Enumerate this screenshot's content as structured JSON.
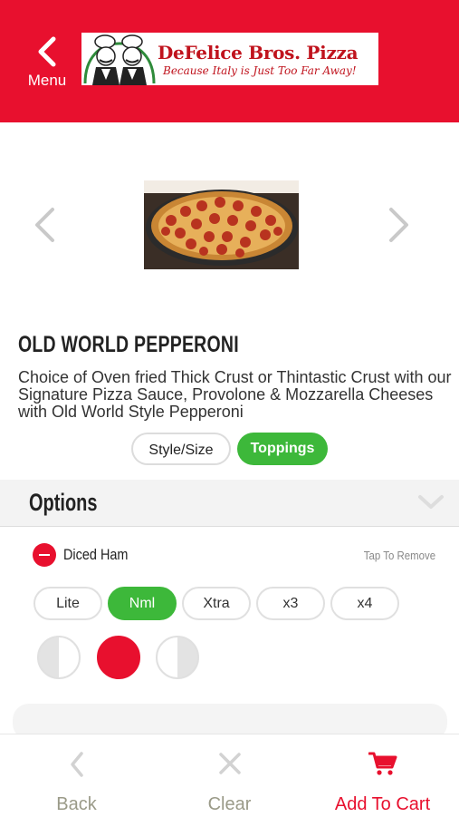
{
  "header": {
    "menu_label": "Menu",
    "logo_title": "DeFelice Bros. Pizza",
    "logo_tagline": "Because Italy is Just Too Far Away!",
    "background_color": "#e8102e"
  },
  "item": {
    "title": "OLD WORLD PEPPERONI",
    "description": "Choice of Oven fried Thick Crust or Thintastic Crust with our Signature Pizza Sauce, Provolone & Mozzarella Cheeses with Old World Style Pepperoni"
  },
  "tabs": {
    "style_size": "Style/Size",
    "toppings": "Toppings",
    "active": "Toppings"
  },
  "options": {
    "title": "Options",
    "topping": {
      "name": "Diced Ham",
      "action_hint": "Tap To Remove",
      "amounts": [
        "Lite",
        "Nml",
        "Xtra",
        "x3",
        "x4"
      ],
      "selected_amount": "Nml",
      "placement_selected": "whole"
    }
  },
  "bottom_bar": {
    "back": "Back",
    "clear": "Clear",
    "add_to_cart": "Add To Cart"
  },
  "colors": {
    "brand_red": "#e8102e",
    "active_green": "#3db83a",
    "muted_label": "#9a9a88"
  }
}
